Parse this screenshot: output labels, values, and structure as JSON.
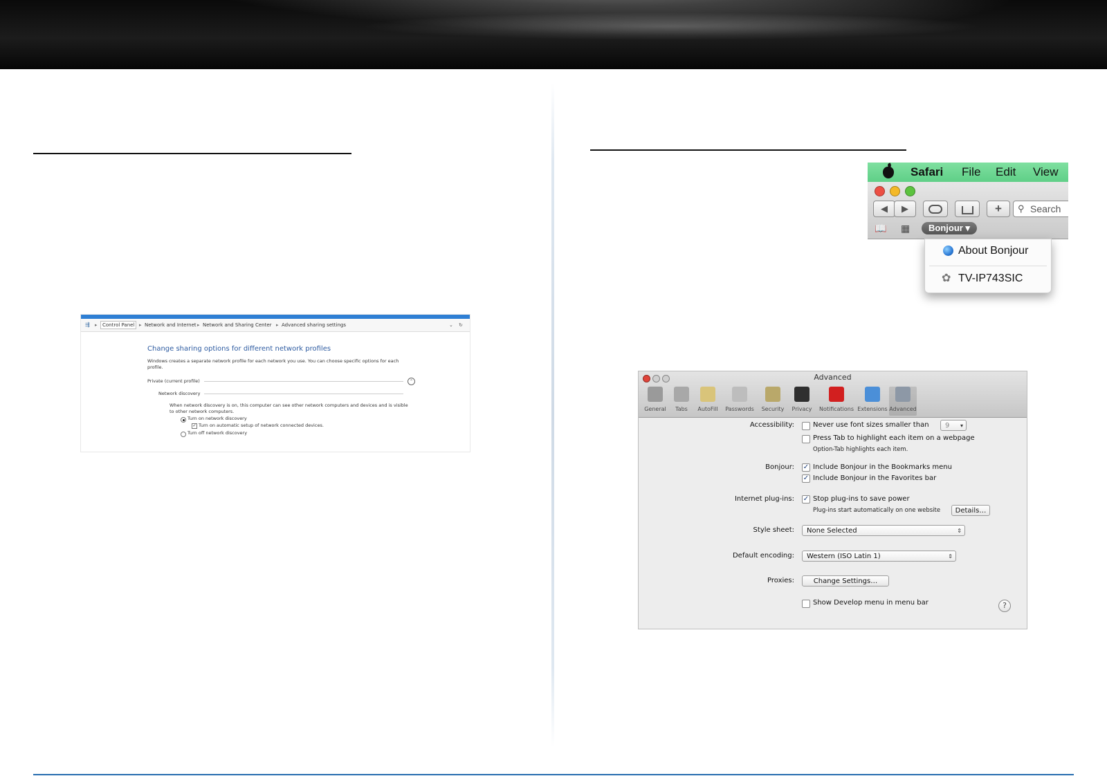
{
  "windows_shot": {
    "breadcrumbs": [
      "Control Panel",
      "Network and Internet",
      "Network and Sharing Center",
      "Advanced sharing settings"
    ],
    "heading": "Change sharing options for different network profiles",
    "description": "Windows creates a separate network profile for each network you use. You can choose specific options for each profile.",
    "profile_label": "Private (current profile)",
    "section_label": "Network discovery",
    "section_description": "When network discovery is on, this computer can see other network computers and devices and is visible to other network computers.",
    "options": {
      "turn_on": "Turn on network discovery",
      "auto_setup": "Turn on automatic setup of network connected devices.",
      "turn_off": "Turn off network discovery"
    },
    "arrow_glyph": "▸",
    "collapse_glyph": "⌃",
    "dropdown_glyph": "⌄",
    "refresh_glyph": "↻",
    "check_glyph": "✓"
  },
  "safari_menu_shot": {
    "menubar": {
      "app": "Safari",
      "file": "File",
      "edit": "Edit",
      "view": "View"
    },
    "search_label": "Search",
    "back_glyph": "◀",
    "forward_glyph": "▶",
    "plus_glyph": "+",
    "search_glyph": "⚲",
    "bookmarks_glyph": "📖",
    "grid_glyph": "▦",
    "bonjour_pill": "Bonjour ▾",
    "menu_items": [
      "About Bonjour",
      "TV-IP743SIC"
    ],
    "bonjour_glyph": "✿",
    "traffic_colors": [
      "#ec4f44",
      "#f4b928",
      "#5cc33f"
    ]
  },
  "prefs_shot": {
    "title": "Advanced",
    "panes": [
      "General",
      "Tabs",
      "AutoFill",
      "Passwords",
      "Security",
      "Privacy",
      "Notifications",
      "Extensions",
      "Advanced"
    ],
    "pane_colors": [
      "#9a9a9a",
      "#a8a8a8",
      "#d9c47a",
      "#bdbdbd",
      "#b9a86a",
      "#2f2f2f",
      "#d21f1f",
      "#4b8fd8",
      "#8d98a6"
    ],
    "rows": {
      "accessibility_label": "Accessibility:",
      "never_font": "Never use font sizes smaller than",
      "font_size": "9",
      "press_tab": "Press Tab to highlight each item on a webpage",
      "option_tab": "Option-Tab highlights each item.",
      "bonjour_label": "Bonjour:",
      "bonjour_bookmarks": "Include Bonjour in the Bookmarks menu",
      "bonjour_favorites": "Include Bonjour in the Favorites bar",
      "plugins_label": "Internet plug-ins:",
      "stop_plugins": "Stop plug-ins to save power",
      "plugins_note": "Plug-ins start automatically on one website",
      "details_button": "Details…",
      "style_label": "Style sheet:",
      "style_value": "None Selected",
      "encoding_label": "Default encoding:",
      "encoding_value": "Western (ISO Latin 1)",
      "proxies_label": "Proxies:",
      "proxies_button": "Change Settings…",
      "develop_menu": "Show Develop menu in menu bar",
      "help_glyph": "?"
    },
    "check_glyph": "✓",
    "select_arrows": "⇕",
    "stepper_glyph": "▾"
  }
}
